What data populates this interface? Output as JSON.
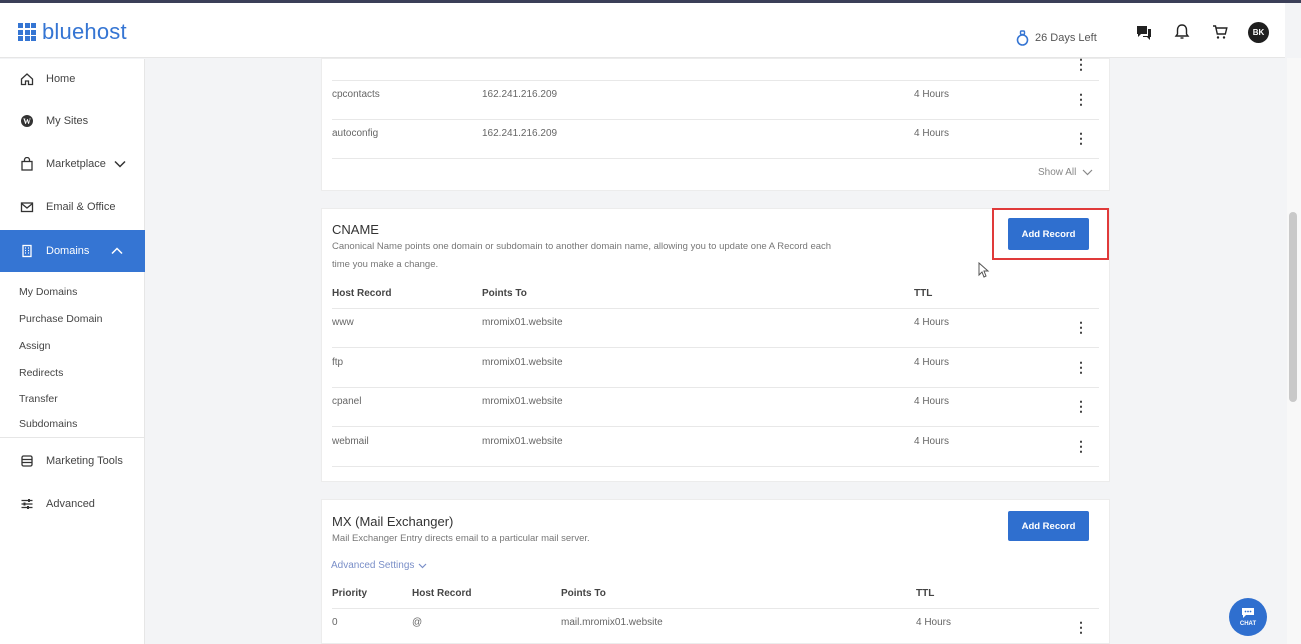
{
  "header": {
    "brand": "bluehost",
    "trial": "26 Days Left",
    "avatar_initials": "BK",
    "icons": [
      "chat-bubble-icon",
      "bell-icon",
      "cart-icon"
    ]
  },
  "sidebar": {
    "items": [
      {
        "label": "Home",
        "icon": "home-icon"
      },
      {
        "label": "My Sites",
        "icon": "wordpress-icon"
      },
      {
        "label": "Marketplace",
        "icon": "bag-icon"
      },
      {
        "label": "Email & Office",
        "icon": "mail-icon"
      },
      {
        "label": "Domains",
        "icon": "building-icon"
      },
      {
        "label": "Marketing Tools",
        "icon": "database-icon"
      },
      {
        "label": "Advanced",
        "icon": "sliders-icon"
      }
    ],
    "sub_items": [
      "My Domains",
      "Purchase Domain",
      "Assign",
      "Redirects",
      "Transfer",
      "Subdomains"
    ]
  },
  "a_records": {
    "rows": [
      {
        "host": "cpcontacts",
        "points_to": "162.241.216.209",
        "ttl": "4 Hours"
      },
      {
        "host": "autoconfig",
        "points_to": "162.241.216.209",
        "ttl": "4 Hours"
      }
    ],
    "show_all": "Show All"
  },
  "cname": {
    "title": "CNAME",
    "description_line1": "Canonical Name points one domain or subdomain to another domain name, allowing you to update one A Record each",
    "description_line2": "time you make a change.",
    "add_record": "Add Record",
    "columns": [
      "Host Record",
      "Points To",
      "TTL"
    ],
    "rows": [
      {
        "host": "www",
        "points_to": "mromix01.website",
        "ttl": "4 Hours"
      },
      {
        "host": "ftp",
        "points_to": "mromix01.website",
        "ttl": "4 Hours"
      },
      {
        "host": "cpanel",
        "points_to": "mromix01.website",
        "ttl": "4 Hours"
      },
      {
        "host": "webmail",
        "points_to": "mromix01.website",
        "ttl": "4 Hours"
      }
    ]
  },
  "mx": {
    "title": "MX (Mail Exchanger)",
    "description": "Mail Exchanger Entry directs email to a particular mail server.",
    "advanced_settings": "Advanced Settings",
    "add_record": "Add Record",
    "columns": [
      "Priority",
      "Host Record",
      "Points To",
      "TTL"
    ],
    "rows": [
      {
        "priority": "0",
        "host": "@",
        "points_to": "mail.mromix01.website",
        "ttl": "4 Hours"
      }
    ]
  },
  "chat_label": "CHAT",
  "colors": {
    "accent": "#2f6fcf",
    "highlight": "#e03a3a"
  }
}
